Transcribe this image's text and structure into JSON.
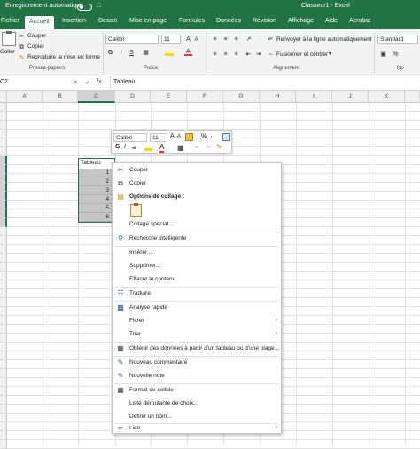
{
  "titlebar": {
    "autosave_label": "Enregistrement automatique",
    "title": "Classeur1 - Excel"
  },
  "menu": {
    "tabs": [
      "Fichier",
      "Accueil",
      "Insertion",
      "Dessin",
      "Mise en page",
      "Formules",
      "Données",
      "Révision",
      "Affichage",
      "Aide",
      "Acrobat"
    ],
    "active_tab": "Accueil"
  },
  "ribbon": {
    "clipboard": {
      "paste_label": "Coller",
      "cut_label": "Couper",
      "copy_label": "Copier",
      "format_painter_label": "Reproduire la mise en forme",
      "group_label": "Presse-papiers"
    },
    "font": {
      "font_name": "Calibri",
      "font_size": "11",
      "bold": "G",
      "italic": "I",
      "underline": "S",
      "group_label": "Police"
    },
    "alignment": {
      "wrap_label": "Renvoyer à la ligne automatiquement",
      "merge_label": "Fusionner et centrer",
      "group_label": "Alignement"
    },
    "number": {
      "format_value": "Standard",
      "group_label": "No"
    }
  },
  "formula_bar": {
    "name_box": "C7",
    "fx_label": "fx",
    "content": "Tableau"
  },
  "grid": {
    "columns": [
      "A",
      "B",
      "C",
      "D",
      "E",
      "F",
      "G",
      "H",
      "I",
      "J",
      "K"
    ],
    "selected_column": "C",
    "header_cell": "Tableau",
    "values": [
      "1",
      "2",
      "3",
      "4",
      "5",
      "6"
    ]
  },
  "mini_toolbar": {
    "font_name": "Calibri",
    "font_size": "11",
    "bold": "G",
    "italic": "I"
  },
  "context_menu": {
    "cut": "Couper",
    "copy": "Copier",
    "paste_options_header": "Options de collage :",
    "paste_special": "Collage spécial...",
    "smart_lookup": "Recherche intelligente",
    "insert": "Insérer...",
    "delete": "Supprimer...",
    "clear_contents": "Effacer le contenu",
    "translate": "Traduire",
    "quick_analysis": "Analyse rapide",
    "filter": "Filtrer",
    "sort": "Trier",
    "get_data": "Obtenir des données à partir d'un tableau ou d'une plage...",
    "new_comment": "Nouveau commentaire",
    "new_note": "Nouvelle note",
    "format_cells": "Format de cellule",
    "dropdown_list": "Liste déroulante de choix...",
    "define_name": "Définir un nom...",
    "link": "Lien"
  },
  "colors": {
    "excel_green": "#217346",
    "font_red": "#e03a2f",
    "highlight_yellow": "#f5d800"
  }
}
